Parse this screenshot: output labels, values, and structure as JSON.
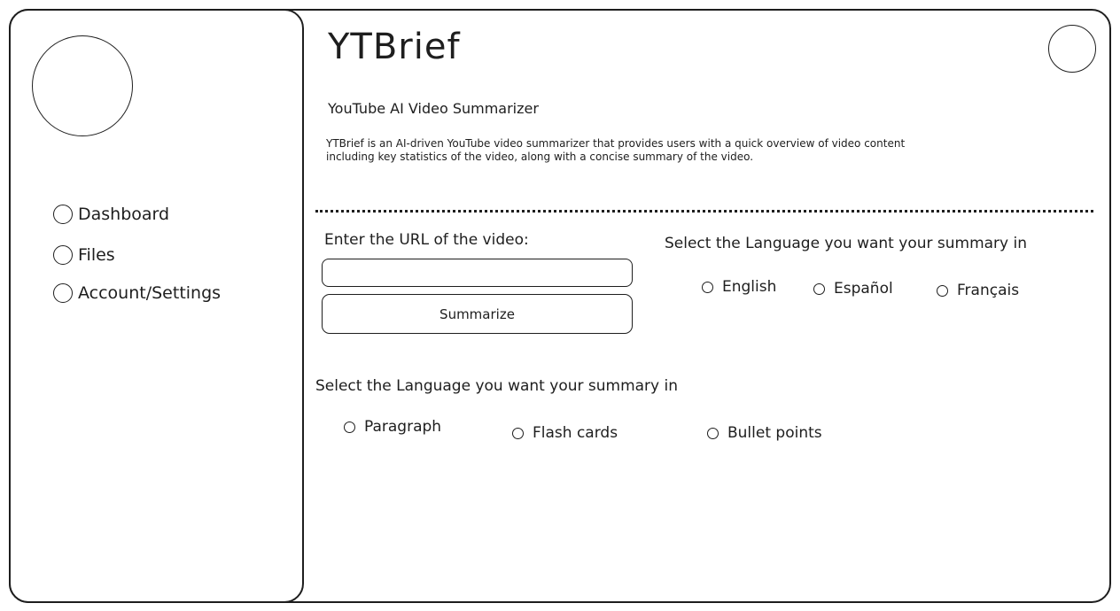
{
  "app": {
    "title": "YTBrief",
    "subtitle": "YouTube AI Video Summarizer",
    "description": "YTBrief is an AI-driven YouTube video summarizer that provides users with a quick overview of video content including key statistics of the video, along with a concise summary of the video."
  },
  "sidebar": {
    "items": [
      {
        "label": "Dashboard"
      },
      {
        "label": "Files"
      },
      {
        "label": "Account/Settings"
      }
    ]
  },
  "url_section": {
    "label": "Enter the URL of the video:",
    "input_value": "",
    "input_placeholder": "",
    "button_label": "Summarize"
  },
  "language_section": {
    "label": "Select the Language you want your summary in",
    "options": [
      {
        "label": "English"
      },
      {
        "label": "Español"
      },
      {
        "label": "Français"
      }
    ]
  },
  "format_section": {
    "label": "Select the Language you want your summary in",
    "options": [
      {
        "label": "Paragraph"
      },
      {
        "label": "Flash cards"
      },
      {
        "label": "Bullet points"
      }
    ]
  }
}
